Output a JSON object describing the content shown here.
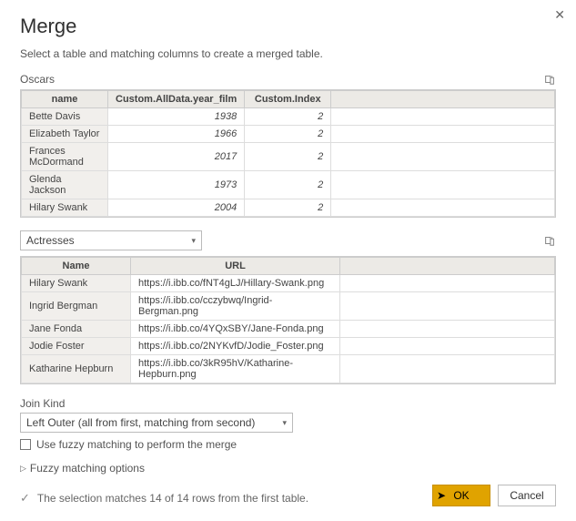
{
  "dialog": {
    "title": "Merge",
    "subtitle": "Select a table and matching columns to create a merged table."
  },
  "table1": {
    "label": "Oscars",
    "headers": {
      "name": "name",
      "year": "Custom.AllData.year_film",
      "index": "Custom.Index"
    },
    "rows": [
      {
        "name": "Bette Davis",
        "year": "1938",
        "index": "2"
      },
      {
        "name": "Elizabeth Taylor",
        "year": "1966",
        "index": "2"
      },
      {
        "name": "Frances McDormand",
        "year": "2017",
        "index": "2"
      },
      {
        "name": "Glenda Jackson",
        "year": "1973",
        "index": "2"
      },
      {
        "name": "Hilary Swank",
        "year": "2004",
        "index": "2"
      }
    ]
  },
  "lookup_select": {
    "value": "Actresses"
  },
  "table2": {
    "headers": {
      "name": "Name",
      "url": "URL"
    },
    "rows": [
      {
        "name": "Hilary Swank",
        "url": "https://i.ibb.co/fNT4gLJ/Hillary-Swank.png"
      },
      {
        "name": "Ingrid Bergman",
        "url": "https://i.ibb.co/cczybwq/Ingrid-Bergman.png"
      },
      {
        "name": "Jane Fonda",
        "url": "https://i.ibb.co/4YQxSBY/Jane-Fonda.png"
      },
      {
        "name": "Jodie Foster",
        "url": "https://i.ibb.co/2NYKvfD/Jodie_Foster.png"
      },
      {
        "name": "Katharine Hepburn",
        "url": "https://i.ibb.co/3kR95hV/Katharine-Hepburn.png"
      }
    ]
  },
  "join": {
    "label": "Join Kind",
    "value": "Left Outer (all from first, matching from second)",
    "fuzzy_checkbox": "Use fuzzy matching to perform the merge",
    "fuzzy_expander": "Fuzzy matching options"
  },
  "status": "The selection matches 14 of 14 rows from the first table.",
  "buttons": {
    "ok": "OK",
    "cancel": "Cancel"
  }
}
